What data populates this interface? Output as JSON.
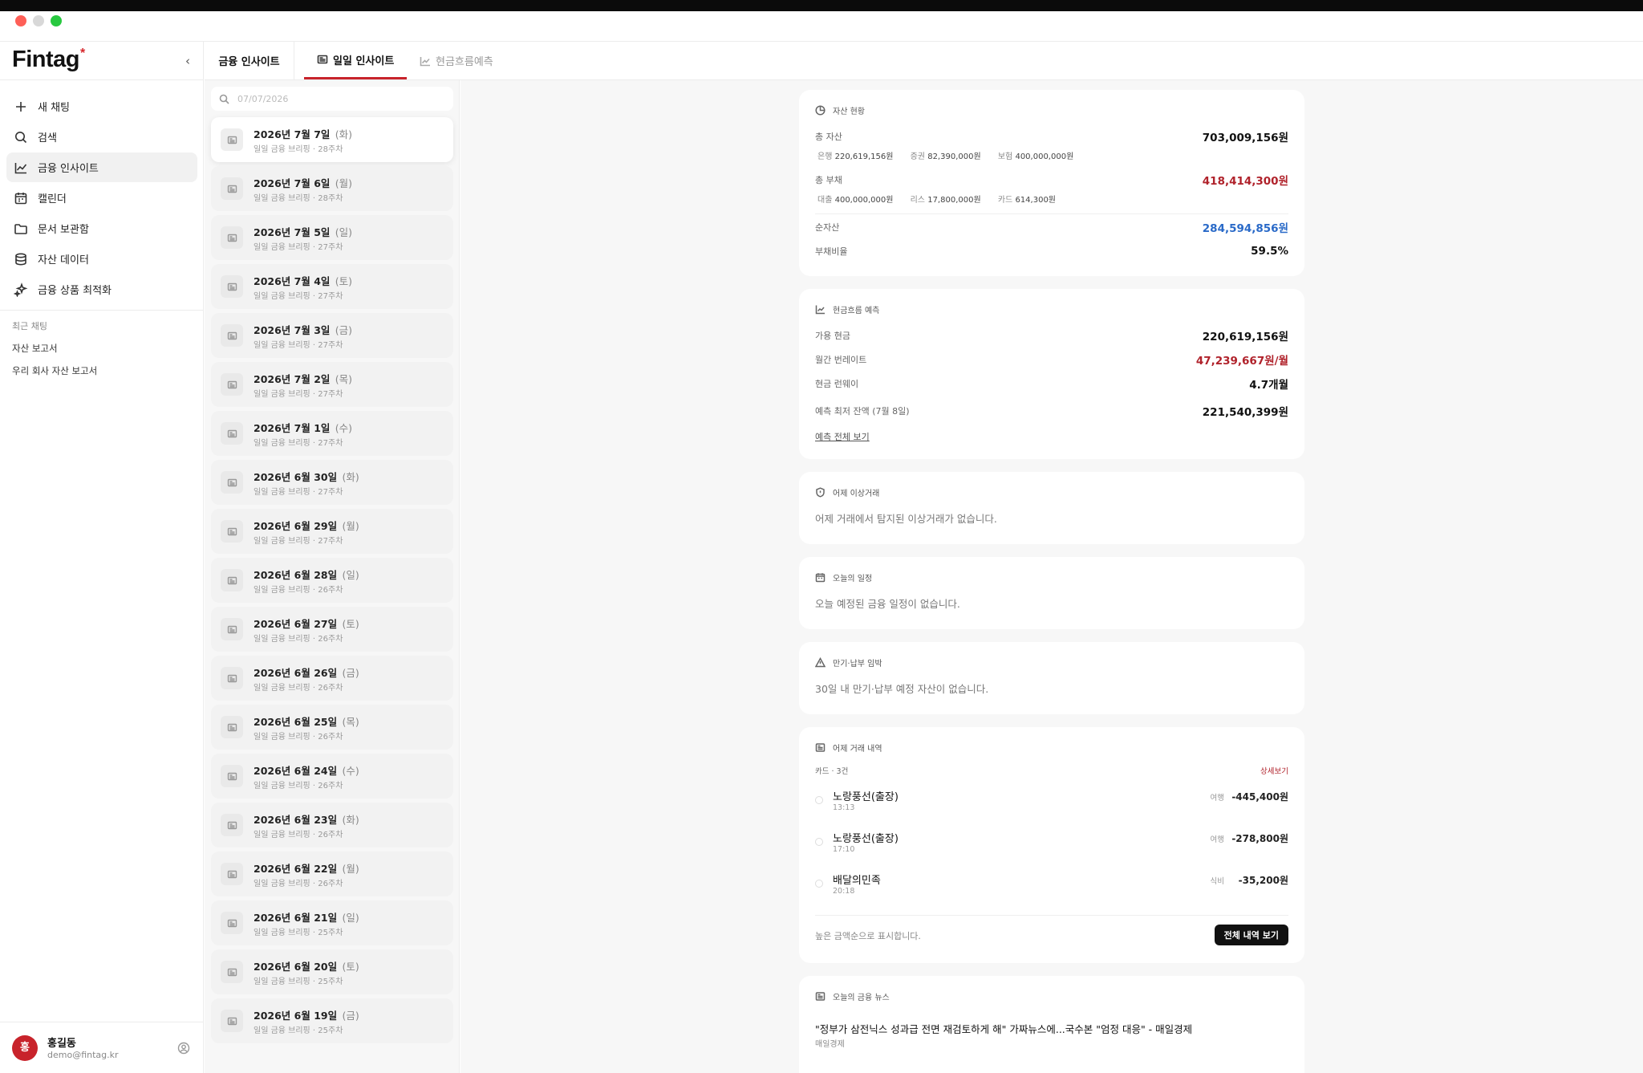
{
  "app": {
    "logo_text": "Fintag",
    "logo_mark": "*"
  },
  "sidebar": {
    "nav": [
      {
        "label": "새 채팅",
        "icon": "plus-icon",
        "active": false
      },
      {
        "label": "검색",
        "icon": "search-icon",
        "active": false
      },
      {
        "label": "금융 인사이트",
        "icon": "chart-icon",
        "active": true
      },
      {
        "label": "캘린더",
        "icon": "calendar-icon",
        "active": false
      },
      {
        "label": "문서 보관함",
        "icon": "folder-icon",
        "active": false
      },
      {
        "label": "자산 데이터",
        "icon": "database-icon",
        "active": false
      },
      {
        "label": "금융 상품 최적화",
        "icon": "sparkle-icon",
        "active": false
      }
    ],
    "recent_label": "최근 채팅",
    "recent": [
      "자산 보고서",
      "우리 회사 자산 보고서"
    ],
    "user": {
      "avatar": "홍",
      "name": "홍길동",
      "email": "demo@fintag.kr"
    }
  },
  "tabs": {
    "first": "금융 인사이트",
    "items": [
      {
        "label": "일일 인사이트",
        "active": true
      },
      {
        "label": "현금흐름예측",
        "active": false
      }
    ]
  },
  "date_list": {
    "search_placeholder": "07/07/2026",
    "items": [
      {
        "title": "2026년 7월 7일",
        "dow": "(화)",
        "sub": "일일 금융 브리핑 · 28주차",
        "selected": true
      },
      {
        "title": "2026년 7월 6일",
        "dow": "(월)",
        "sub": "일일 금융 브리핑 · 28주차"
      },
      {
        "title": "2026년 7월 5일",
        "dow": "(일)",
        "sub": "일일 금융 브리핑 · 27주차"
      },
      {
        "title": "2026년 7월 4일",
        "dow": "(토)",
        "sub": "일일 금융 브리핑 · 27주차"
      },
      {
        "title": "2026년 7월 3일",
        "dow": "(금)",
        "sub": "일일 금융 브리핑 · 27주차"
      },
      {
        "title": "2026년 7월 2일",
        "dow": "(목)",
        "sub": "일일 금융 브리핑 · 27주차"
      },
      {
        "title": "2026년 7월 1일",
        "dow": "(수)",
        "sub": "일일 금융 브리핑 · 27주차"
      },
      {
        "title": "2026년 6월 30일",
        "dow": "(화)",
        "sub": "일일 금융 브리핑 · 27주차"
      },
      {
        "title": "2026년 6월 29일",
        "dow": "(월)",
        "sub": "일일 금융 브리핑 · 27주차"
      },
      {
        "title": "2026년 6월 28일",
        "dow": "(일)",
        "sub": "일일 금융 브리핑 · 26주차"
      },
      {
        "title": "2026년 6월 27일",
        "dow": "(토)",
        "sub": "일일 금융 브리핑 · 26주차"
      },
      {
        "title": "2026년 6월 26일",
        "dow": "(금)",
        "sub": "일일 금융 브리핑 · 26주차"
      },
      {
        "title": "2026년 6월 25일",
        "dow": "(목)",
        "sub": "일일 금융 브리핑 · 26주차"
      },
      {
        "title": "2026년 6월 24일",
        "dow": "(수)",
        "sub": "일일 금융 브리핑 · 26주차"
      },
      {
        "title": "2026년 6월 23일",
        "dow": "(화)",
        "sub": "일일 금융 브리핑 · 26주차"
      },
      {
        "title": "2026년 6월 22일",
        "dow": "(월)",
        "sub": "일일 금융 브리핑 · 26주차"
      },
      {
        "title": "2026년 6월 21일",
        "dow": "(일)",
        "sub": "일일 금융 브리핑 · 25주차"
      },
      {
        "title": "2026년 6월 20일",
        "dow": "(토)",
        "sub": "일일 금융 브리핑 · 25주차"
      },
      {
        "title": "2026년 6월 19일",
        "dow": "(금)",
        "sub": "일일 금융 브리핑 · 25주차"
      }
    ]
  },
  "assets": {
    "title": "자산 현황",
    "total_assets_label": "총 자산",
    "total_assets": "703,009,156원",
    "assets_breakdown": [
      {
        "label": "은행",
        "value": "220,619,156원"
      },
      {
        "label": "증권",
        "value": "82,390,000원"
      },
      {
        "label": "보험",
        "value": "400,000,000원"
      }
    ],
    "total_liab_label": "총 부채",
    "total_liab": "418,414,300원",
    "liab_breakdown": [
      {
        "label": "대출",
        "value": "400,000,000원"
      },
      {
        "label": "리스",
        "value": "17,800,000원"
      },
      {
        "label": "카드",
        "value": "614,300원"
      }
    ],
    "net_label": "순자산",
    "net": "284,594,856원",
    "ratio_label": "부채비율",
    "ratio": "59.5%"
  },
  "cashflow": {
    "title": "현금흐름 예측",
    "rows": [
      {
        "label": "가용 현금",
        "value": "220,619,156원",
        "tone": "normal"
      },
      {
        "label": "월간 번레이트",
        "value": "47,239,667원/월",
        "tone": "red"
      },
      {
        "label": "현금 런웨이",
        "value": "4.7개월",
        "tone": "normal"
      },
      {
        "label": "예측 최저 잔액 (7월 8일)",
        "value": "221,540,399원",
        "tone": "normal"
      }
    ],
    "link": "예측 전체 보기"
  },
  "anomaly": {
    "title": "어제 이상거래",
    "text": "어제 거래에서 탐지된 이상거래가 없습니다."
  },
  "schedule": {
    "title": "오늘의 일정",
    "text": "오늘 예정된 금융 일정이 없습니다."
  },
  "due": {
    "title": "만기·납부 임박",
    "text": "30일 내 만기·납부 예정 자산이 없습니다."
  },
  "transactions": {
    "title": "어제 거래 내역",
    "count": "카드 · 3건",
    "detail_link": "상세보기",
    "items": [
      {
        "name": "노랑풍선(출장)",
        "time": "13:13",
        "category": "여행",
        "amount": "-445,400원"
      },
      {
        "name": "노랑풍선(출장)",
        "time": "17:10",
        "category": "여행",
        "amount": "-278,800원"
      },
      {
        "name": "배달의민족",
        "time": "20:18",
        "category": "식비",
        "amount": "-35,200원"
      }
    ],
    "footnote": "높은 금액순으로 표시합니다.",
    "button": "전체 내역 보기"
  },
  "news": {
    "title": "오늘의 금융 뉴스",
    "items": [
      {
        "headline": "\"정부가 삼전닉스 성과급 전면 재검토하게 해\" 가짜뉴스에...국수본 \"엄정 대응\" - 매일경제",
        "source": "매일경제"
      }
    ]
  },
  "colors": {
    "accent": "#c8232b",
    "negative": "#b0222b",
    "positive": "#2a6ac8"
  }
}
